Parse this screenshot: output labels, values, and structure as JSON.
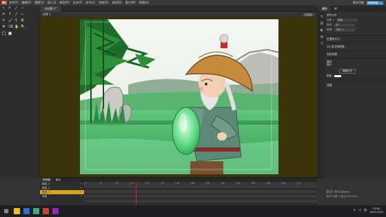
{
  "menubar": {
    "logo": "An",
    "items": [
      "文件(F)",
      "编辑(E)",
      "视图(V)",
      "插入(I)",
      "修改(M)",
      "文本(T)",
      "命令(C)",
      "控制(O)",
      "调试(D)",
      "窗口(W)",
      "帮助(H)"
    ],
    "workspace": "基本功能",
    "search_placeholder": "搜索帮助"
  },
  "document": {
    "tab": "无标题-1*",
    "scene": "场景 1",
    "zoom": "100%"
  },
  "tools": {
    "icons": [
      "select-icon",
      "subselect-icon",
      "free-transform-icon",
      "lasso-icon",
      "pen-icon",
      "text-icon",
      "line-icon",
      "rectangle-icon",
      "pencil-icon",
      "brush-icon",
      "bone-icon",
      "paint-bucket-icon",
      "eyedropper-icon",
      "eraser-icon",
      "hand-icon",
      "zoom-icon"
    ],
    "glyphs": [
      "↖",
      "⇱",
      "⤢",
      "⌁",
      "✒",
      "T",
      "╱",
      "▭",
      "✎",
      "🖌",
      "⚲",
      "⛾",
      "✚",
      "⌫",
      "✋",
      "🔍"
    ],
    "stroke_color": "#000000",
    "fill_color": "#ffffff"
  },
  "props": {
    "tabs": [
      "属性",
      "库"
    ],
    "title": "图形元件",
    "instance_of": "元件 1",
    "swap_label": "交换",
    "fields": [
      {
        "label": "样式:",
        "value": "无"
      },
      {
        "label": "实例:",
        "value": "元件 1"
      }
    ],
    "sections": [
      "位置和大小",
      "3D 定位和视图",
      "色彩效果",
      "循环"
    ],
    "loop_label": "循环",
    "button_label": "编辑元件",
    "color_label": "颜色:",
    "filter_section": "滤镜"
  },
  "timeline": {
    "tabs": [
      "时间轴",
      "输出"
    ],
    "layers": [
      {
        "name": "图层_3",
        "selected": false
      },
      {
        "name": "图层_2",
        "selected": false
      },
      {
        "name": "图层_1",
        "selected": true
      },
      {
        "name": "背景",
        "selected": false
      }
    ],
    "ruler": [
      "1",
      "5",
      "10",
      "15",
      "20",
      "25",
      "30",
      "35",
      "40",
      "45",
      "50",
      "55",
      "60",
      "65",
      "70"
    ],
    "current_frame": 17
  },
  "taskbar": {
    "time": "15:00",
    "date": "2021/7/22",
    "tray_lang": "中",
    "task_colors": [
      "#f0c010",
      "#2a6fd8",
      "#3cb371",
      "#c8462a",
      "#9c27b0"
    ]
  },
  "watermark": {
    "line1": "激活 Windows",
    "line2": "转到“设置”以激活 Windows。"
  }
}
